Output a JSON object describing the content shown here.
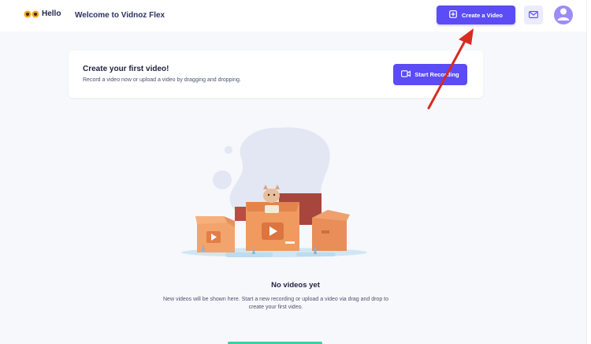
{
  "header": {
    "logo_text": "Hello",
    "welcome": "Welcome to Vidnoz Flex",
    "create_label": "Create a Video",
    "icons": {
      "create": "plus-square-icon",
      "mail": "mail-icon",
      "avatar": "user-avatar-icon"
    }
  },
  "card": {
    "title": "Create your first video!",
    "subtitle": "Record a video now or upload a video by dragging and dropping.",
    "record_label": "Start Recording",
    "record_icon": "video-camera-icon"
  },
  "empty": {
    "title": "No videos yet",
    "desc": "New videos will be shown here. Start a new recording or upload a video via drag and drop to create your first video."
  },
  "colors": {
    "accent": "#5b4cf6",
    "arrow": "#d92b1f",
    "background": "#f7f8fc"
  }
}
